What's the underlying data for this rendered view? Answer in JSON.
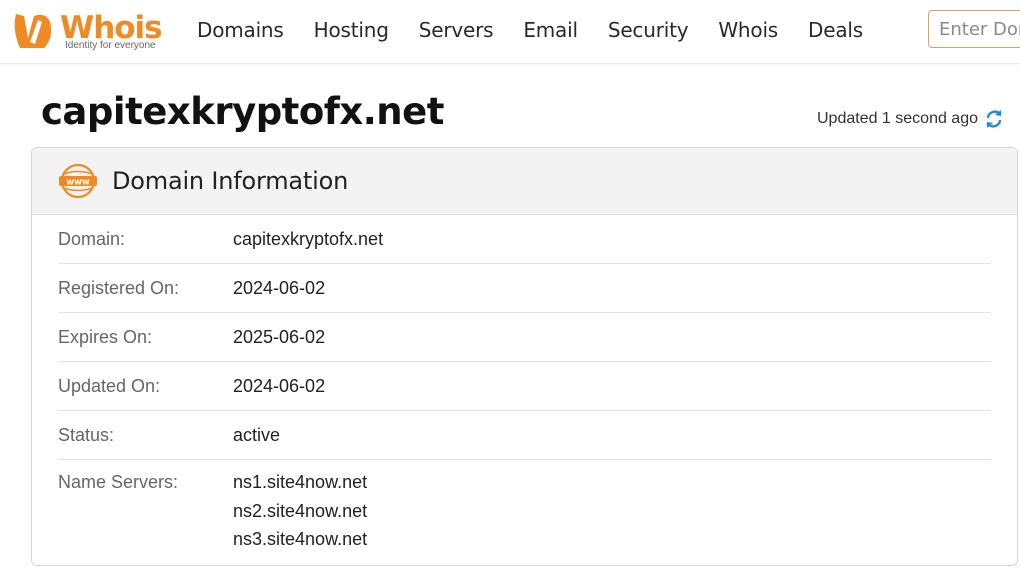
{
  "header": {
    "logo_text": "Whois",
    "logo_tagline": "Identity for everyone",
    "nav": [
      "Domains",
      "Hosting",
      "Servers",
      "Email",
      "Security",
      "Whois",
      "Deals"
    ],
    "search_placeholder": "Enter Domain"
  },
  "page": {
    "title": "capitexkryptofx.net",
    "updated_text": "Updated 1 second ago"
  },
  "card": {
    "title": "Domain Information",
    "rows": [
      {
        "label": "Domain:",
        "value": "capitexkryptofx.net"
      },
      {
        "label": "Registered On:",
        "value": "2024-06-02"
      },
      {
        "label": "Expires On:",
        "value": "2025-06-02"
      },
      {
        "label": "Updated On:",
        "value": "2024-06-02"
      },
      {
        "label": "Status:",
        "value": "active"
      }
    ],
    "name_servers_label": "Name Servers:",
    "name_servers": [
      "ns1.site4now.net",
      "ns2.site4now.net",
      "ns3.site4now.net"
    ]
  },
  "colors": {
    "brand_orange": "#f08a24",
    "refresh_blue": "#1e88e5"
  },
  "icons": [
    "whois-logo-icon",
    "refresh-icon",
    "www-globe-icon"
  ]
}
